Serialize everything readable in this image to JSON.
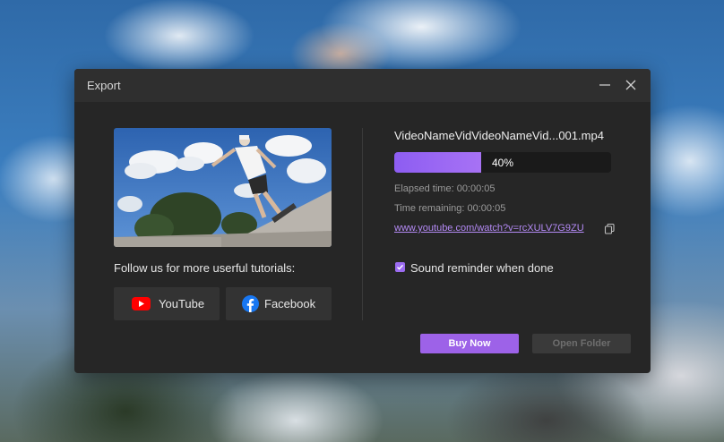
{
  "dialog": {
    "title": "Export",
    "controls": {
      "minimize_icon": "minimize-icon",
      "close_icon": "close-icon"
    }
  },
  "left": {
    "follow_text": "Follow us for more userful tutorials:",
    "youtube_label": "YouTube",
    "facebook_label": "Facebook",
    "youtube_icon": "youtube-icon",
    "facebook_icon": "facebook-icon"
  },
  "right": {
    "filename": "VideoNameVidVideoNameVid...001.mp4",
    "progress_percent": 40,
    "progress_label": "40%",
    "elapsed": "Elapsed time: 00:00:05",
    "remaining": "Time remaining: 00:00:05",
    "link": "www.youtube.com/watch?v=rcXULV7G9ZU",
    "copy_icon": "copy-icon",
    "sound_reminder_label": "Sound reminder when done",
    "sound_reminder_checked": true
  },
  "footer": {
    "buy_label": "Buy Now",
    "open_folder_label": "Open Folder",
    "open_folder_disabled": true
  },
  "colors": {
    "accent": "#9d62e8",
    "progress_fill": "#8d5df2",
    "link": "#b48af5",
    "dialog_bg": "#262626"
  }
}
